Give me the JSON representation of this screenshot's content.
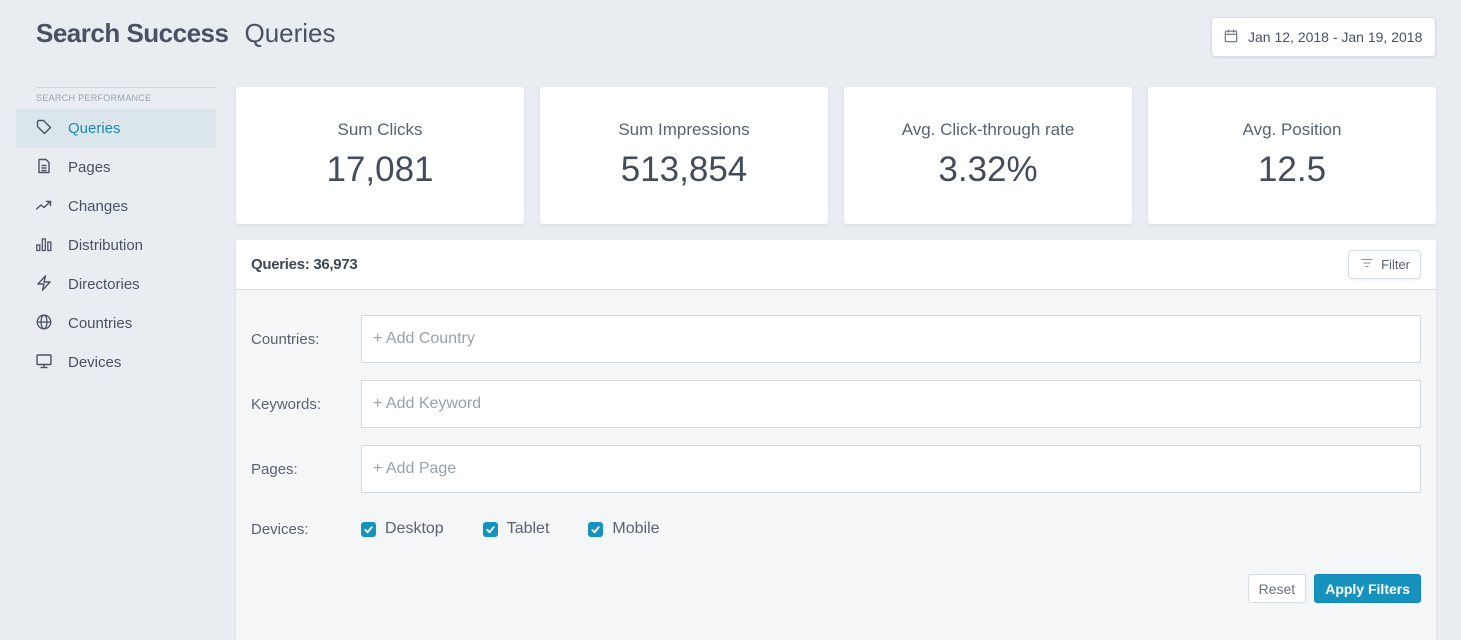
{
  "header": {
    "brand": "Search Success",
    "title": "Queries",
    "date_range": "Jan 12, 2018 - Jan 19, 2018",
    "date_icon": "calendar-icon"
  },
  "sidebar": {
    "section_label": "SEARCH PERFORMANCE",
    "items": [
      {
        "label": "Queries",
        "icon": "tag-icon",
        "active": true
      },
      {
        "label": "Pages",
        "icon": "document-icon",
        "active": false
      },
      {
        "label": "Changes",
        "icon": "trending-up-icon",
        "active": false
      },
      {
        "label": "Distribution",
        "icon": "bar-chart-icon",
        "active": false
      },
      {
        "label": "Directories",
        "icon": "lightning-icon",
        "active": false
      },
      {
        "label": "Countries",
        "icon": "globe-icon",
        "active": false
      },
      {
        "label": "Devices",
        "icon": "monitor-icon",
        "active": false
      }
    ]
  },
  "metrics": [
    {
      "label": "Sum Clicks",
      "value": "17,081"
    },
    {
      "label": "Sum Impressions",
      "value": "513,854"
    },
    {
      "label": "Avg. Click-through rate",
      "value": "3.32%"
    },
    {
      "label": "Avg. Position",
      "value": "12.5"
    }
  ],
  "panel": {
    "title": "Queries: 36,973",
    "filter_label": "Filter",
    "filter_icon": "filter-lines-icon",
    "fields": {
      "countries": {
        "label": "Countries:",
        "placeholder": "+ Add Country"
      },
      "keywords": {
        "label": "Keywords:",
        "placeholder": "+ Add Keyword"
      },
      "pages": {
        "label": "Pages:",
        "placeholder": "+ Add Page"
      }
    },
    "devices": {
      "label": "Devices:",
      "options": [
        {
          "label": "Desktop",
          "checked": true
        },
        {
          "label": "Tablet",
          "checked": true
        },
        {
          "label": "Mobile",
          "checked": true
        }
      ]
    },
    "reset_label": "Reset",
    "apply_label": "Apply Filters"
  },
  "colors": {
    "accent": "#1592be",
    "background": "#e9edf1",
    "active_nav_bg": "#dbe6ec",
    "text": "#4a5262"
  }
}
